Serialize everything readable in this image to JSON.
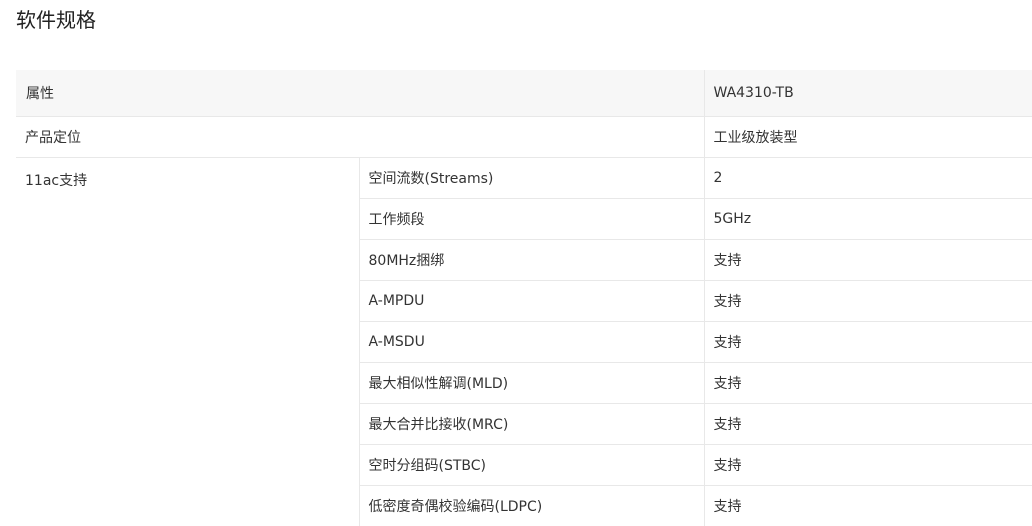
{
  "page": {
    "title": "软件规格"
  },
  "table": {
    "header": {
      "attribute": "属性",
      "model": "WA4310-TB"
    },
    "positioning": {
      "label": "产品定位",
      "value": "工业级放装型"
    },
    "ac_group": {
      "label": "11ac支持",
      "rows": [
        {
          "name": "空间流数(Streams)",
          "value": "2"
        },
        {
          "name": "工作频段",
          "value": "5GHz"
        },
        {
          "name": "80MHz捆绑",
          "value": "支持"
        },
        {
          "name": "A-MPDU",
          "value": "支持"
        },
        {
          "name": "A-MSDU",
          "value": "支持"
        },
        {
          "name": "最大相似性解调(MLD)",
          "value": "支持"
        },
        {
          "name": "最大合并比接收(MRC)",
          "value": "支持"
        },
        {
          "name": "空时分组码(STBC)",
          "value": "支持"
        },
        {
          "name": "低密度奇偶校验编码(LDPC)",
          "value": "支持"
        }
      ]
    }
  }
}
